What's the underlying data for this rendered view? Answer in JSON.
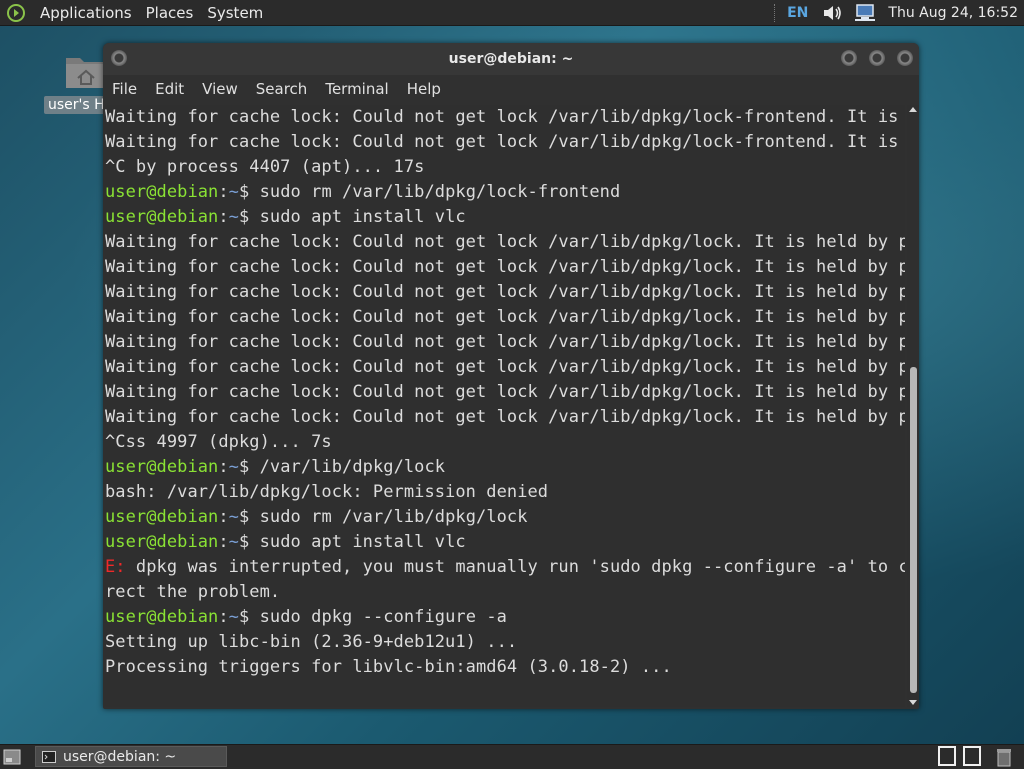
{
  "top_panel": {
    "menus": [
      "Applications",
      "Places",
      "System"
    ],
    "keyboard_layout": "EN",
    "clock": "Thu Aug 24, 16:52"
  },
  "desktop": {
    "home_icon_label": "user's H"
  },
  "terminal": {
    "title": "user@debian: ~",
    "menu": [
      "File",
      "Edit",
      "View",
      "Search",
      "Terminal",
      "Help"
    ],
    "prompt": {
      "user": "user@debian",
      "sep": ":",
      "path": "~",
      "symbol": "$ "
    },
    "lines": [
      {
        "kind": "out",
        "text": "Waiting for cache lock: Could not get lock /var/lib/dpkg/lock-frontend. It is he"
      },
      {
        "kind": "out",
        "text": "Waiting for cache lock: Could not get lock /var/lib/dpkg/lock-frontend. It is he"
      },
      {
        "kind": "out",
        "text": "^C by process 4407 (apt)... 17s"
      },
      {
        "kind": "cmd",
        "text": "sudo rm /var/lib/dpkg/lock-frontend"
      },
      {
        "kind": "cmd",
        "text": "sudo apt install vlc"
      },
      {
        "kind": "out",
        "text": "Waiting for cache lock: Could not get lock /var/lib/dpkg/lock. It is held by pro"
      },
      {
        "kind": "out",
        "text": "Waiting for cache lock: Could not get lock /var/lib/dpkg/lock. It is held by pro"
      },
      {
        "kind": "out",
        "text": "Waiting for cache lock: Could not get lock /var/lib/dpkg/lock. It is held by pro"
      },
      {
        "kind": "out",
        "text": "Waiting for cache lock: Could not get lock /var/lib/dpkg/lock. It is held by pro"
      },
      {
        "kind": "out",
        "text": "Waiting for cache lock: Could not get lock /var/lib/dpkg/lock. It is held by pro"
      },
      {
        "kind": "out",
        "text": "Waiting for cache lock: Could not get lock /var/lib/dpkg/lock. It is held by pro"
      },
      {
        "kind": "out",
        "text": "Waiting for cache lock: Could not get lock /var/lib/dpkg/lock. It is held by pro"
      },
      {
        "kind": "out",
        "text": "Waiting for cache lock: Could not get lock /var/lib/dpkg/lock. It is held by pro"
      },
      {
        "kind": "out",
        "text": "^Css 4997 (dpkg)... 7s"
      },
      {
        "kind": "cmd",
        "text": "/var/lib/dpkg/lock"
      },
      {
        "kind": "out",
        "text": "bash: /var/lib/dpkg/lock: Permission denied"
      },
      {
        "kind": "cmd",
        "text": "sudo rm /var/lib/dpkg/lock"
      },
      {
        "kind": "cmd",
        "text": "sudo apt install vlc"
      },
      {
        "kind": "err",
        "prefix": "E: ",
        "text": "dpkg was interrupted, you must manually run 'sudo dpkg --configure -a' to cor"
      },
      {
        "kind": "out",
        "text": "rect the problem."
      },
      {
        "kind": "cmd",
        "text": "sudo dpkg --configure -a"
      },
      {
        "kind": "out",
        "text": "Setting up libc-bin (2.36-9+deb12u1) ..."
      },
      {
        "kind": "out",
        "text": "Processing triggers for libvlc-bin:amd64 (3.0.18-2) ..."
      }
    ]
  },
  "taskbar": {
    "task_label": "user@debian: ~"
  },
  "colors": {
    "prompt_user": "#8ae234",
    "prompt_path": "#7a9fd4",
    "error": "#ef2929"
  }
}
